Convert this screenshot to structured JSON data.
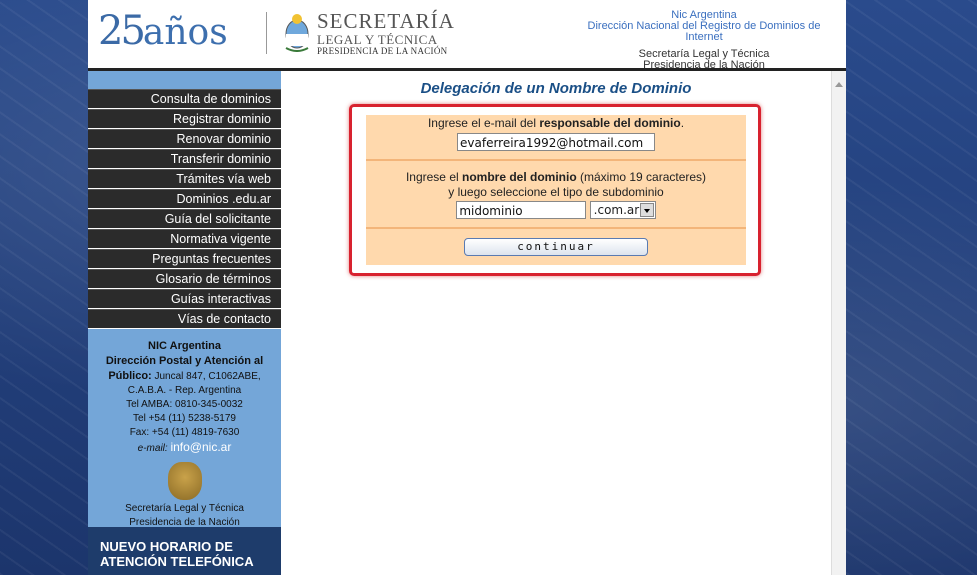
{
  "header": {
    "logo_number": "25",
    "logo_word": "años",
    "secretaria_line1": "SECRETARÍA",
    "secretaria_line2": "LEGAL Y TÉCNICA",
    "secretaria_line3": "PRESIDENCIA DE LA NACIÓN",
    "right_line1": "Nic Argentina",
    "right_line2": "Dirección Nacional del Registro de Dominios de Internet",
    "right_line3": "Secretaría Legal y Técnica",
    "right_line4": "Presidencia de la Nación"
  },
  "menu": [
    {
      "label": "Consulta de dominios"
    },
    {
      "label": "Registrar dominio"
    },
    {
      "label": "Renovar dominio"
    },
    {
      "label": "Transferir dominio"
    },
    {
      "label": "Trámites vía web"
    },
    {
      "label": "Dominios .edu.ar"
    },
    {
      "label": "Guía del solicitante"
    },
    {
      "label": "Normativa vigente"
    },
    {
      "label": "Preguntas frecuentes"
    },
    {
      "label": "Glosario de términos"
    },
    {
      "label": "Guías interactivas"
    },
    {
      "label": "Vías de contacto"
    }
  ],
  "info": {
    "org": "NIC Argentina",
    "address_heading": "Dirección Postal y Atención al",
    "address_heading2": "Público:",
    "address1": " Juncal 847, C1062ABE,",
    "address2": "C.A.B.A. - Rep. Argentina",
    "tel_amba": "Tel AMBA: 0810-345-0032",
    "tel": "Tel +54 (11) 5238-5179",
    "fax": "Fax: +54 (11) 4819-7630",
    "email_label": "e-mail:",
    "email": "info@nic.ar",
    "footer1": "Secretaría Legal y Técnica",
    "footer2": "Presidencia de la Nación"
  },
  "notice": {
    "line1": "NUEVO HORARIO DE",
    "line2": "ATENCIÓN TELEFÓNICA"
  },
  "form": {
    "title": "Delegación de un Nombre de Dominio",
    "email_prompt_pre": "Ingrese el e-mail del ",
    "email_prompt_bold": "responsable del dominio",
    "email_prompt_post": ".",
    "email_value": "evaferreira1992@hotmail.com",
    "domain_prompt_pre": "Ingrese el ",
    "domain_prompt_bold": "nombre del dominio",
    "domain_prompt_post": " (máximo 19 caracteres)",
    "domain_prompt_line2": "y luego seleccione el tipo de subdominio",
    "domain_value": "midominio",
    "subdomain_selected": ".com.ar",
    "continue_label": "continuar"
  },
  "colors": {
    "form_bg": "#ffd9ad",
    "highlight_border": "#d8222f",
    "title": "#1a4f86",
    "sidebar_blue": "#74a6d8",
    "menu_bg": "#2b2b2b"
  }
}
